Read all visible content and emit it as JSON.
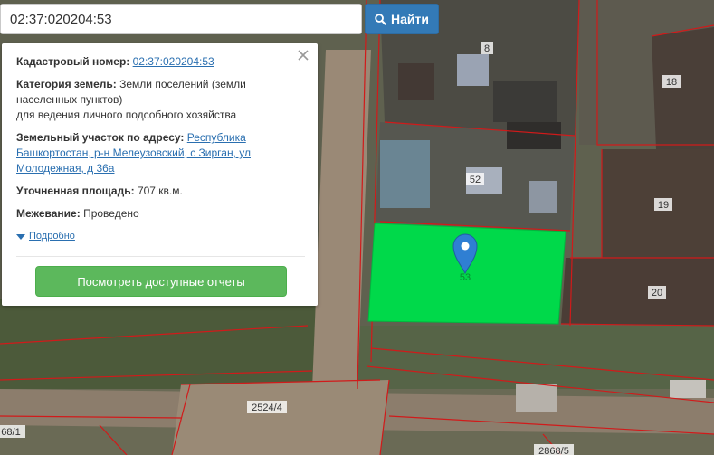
{
  "search": {
    "value": "02:37:020204:53"
  },
  "search_button": {
    "label": "Найти",
    "color": "#337ab7"
  },
  "popup": {
    "cadastral_label": "Кадастровый номер:",
    "cadastral_value": "02:37:020204:53",
    "category_label": "Категория земель:",
    "category_value": "Земли поселений (земли",
    "category_value_2": "населенных пунктов)",
    "usage": "для ведения личного подсобного хозяйства",
    "address_label": "Земельный участок по адресу:",
    "address_line_1": "Республика",
    "address_line_2": "Башкортостан, р-н Мелеузовский, с Зирган, ул",
    "address_line_3": "Молодежная, д 36а",
    "area_label": "Уточненная площадь:",
    "area_value": "707 кв.м.",
    "survey_label": "Межевание:",
    "survey_value": "Проведено",
    "more_link": "Подробно",
    "report_button": "Посмотреть доступные отчеты",
    "report_button_color": "#5cb85c"
  },
  "map": {
    "highlight_color": "#00d94a",
    "selected_parcel_label": "53",
    "parcel_labels": [
      "8",
      "18",
      "52",
      "19",
      "20",
      "2524/4",
      "68/1",
      "2868/5"
    ]
  }
}
